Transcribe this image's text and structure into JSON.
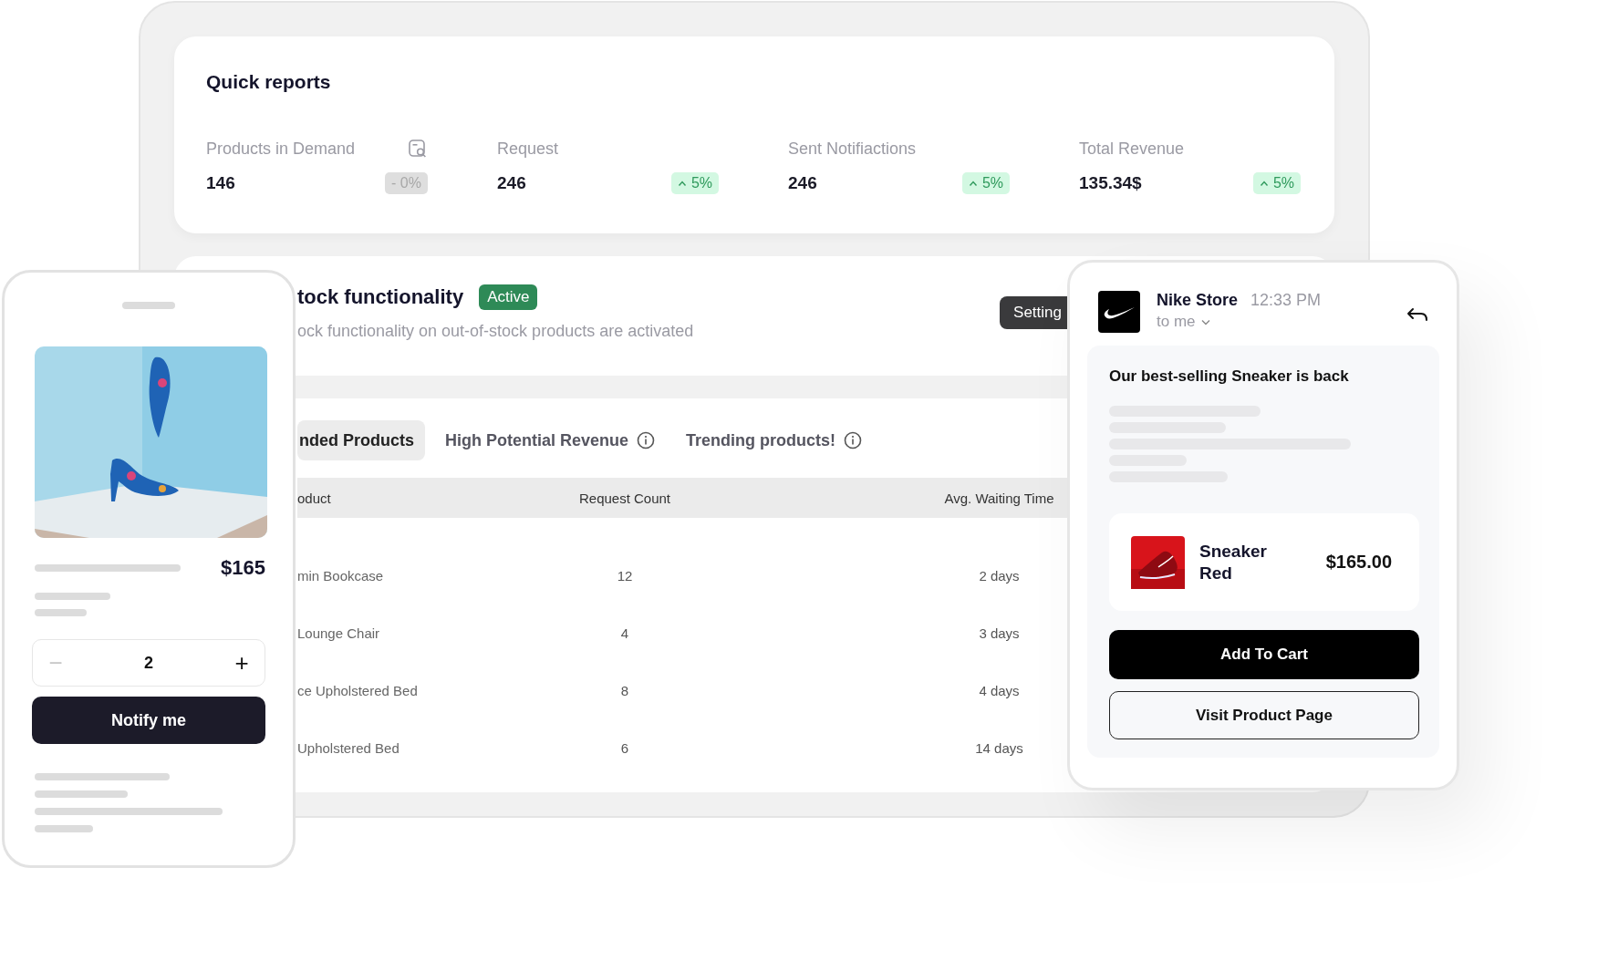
{
  "dashboard": {
    "quick_reports": {
      "title": "Quick reports",
      "stats": [
        {
          "label": "Products in Demand",
          "value": "146",
          "change": "- 0%",
          "kind": "flat",
          "action_icon": true
        },
        {
          "label": "Request",
          "value": "246",
          "change": "5%",
          "kind": "up"
        },
        {
          "label": "Sent Notifiactions",
          "value": "246",
          "change": "5%",
          "kind": "up"
        },
        {
          "label": "Total Revenue",
          "value": "135.34$",
          "change": "5%",
          "kind": "up"
        }
      ]
    },
    "stock": {
      "title": "tock functionality",
      "status": "Active",
      "active": true,
      "description": "ock functionality on out-of-stock products are activated",
      "button": "Setting"
    },
    "tabs": [
      {
        "label": "nded Products",
        "selected": true,
        "info": false
      },
      {
        "label": "High Potential Revenue",
        "selected": false,
        "info": true
      },
      {
        "label": "Trending products!",
        "selected": false,
        "info": true
      }
    ],
    "table": {
      "columns": [
        "oduct",
        "Request Count",
        "Avg. Waiting Time"
      ],
      "rows": [
        [
          "min Bookcase",
          "12",
          "2 days"
        ],
        [
          "Lounge Chair",
          "4",
          "3 days"
        ],
        [
          "ce Upholstered Bed",
          "8",
          "4 days"
        ],
        [
          "Upholstered Bed",
          "6",
          "14 days"
        ]
      ]
    }
  },
  "phone": {
    "price": "$165",
    "decrement": "−",
    "decrement_disabled": true,
    "quantity": "2",
    "increment": "+",
    "button": "Notify me"
  },
  "email": {
    "sender": "Nike Store",
    "time": "12:33 PM",
    "recipient": "to me",
    "subject": "Our best-selling Sneaker is back",
    "product": {
      "name": "Sneaker Red",
      "price": "$165.00"
    },
    "buttons": [
      {
        "label": "Add To Cart",
        "kind": "primary"
      },
      {
        "label": "Visit Product Page",
        "kind": "secondary"
      }
    ]
  }
}
